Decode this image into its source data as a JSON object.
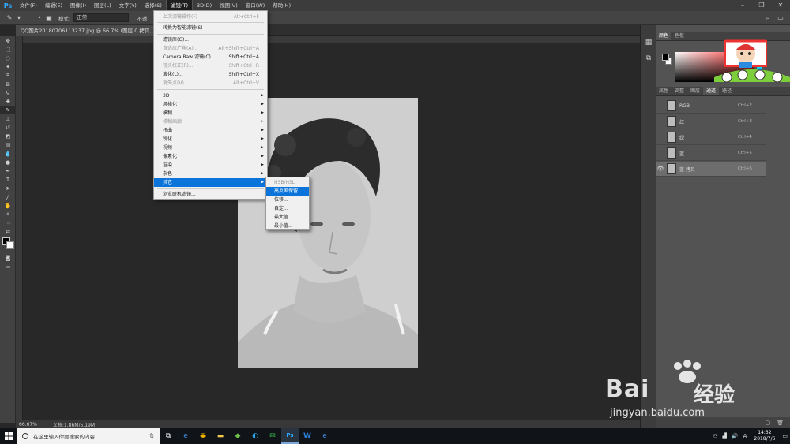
{
  "app": {
    "logo": "Ps"
  },
  "menubar": {
    "items": [
      "文件(F)",
      "编辑(E)",
      "图像(I)",
      "图层(L)",
      "文字(Y)",
      "选择(S)",
      "滤镜(T)",
      "3D(D)",
      "视图(V)",
      "窗口(W)",
      "帮助(H)"
    ],
    "active_index": 6
  },
  "options": {
    "mode_label": "模式:",
    "mode_value": "正常",
    "opacity_label": "不透"
  },
  "document": {
    "tab_title": "QQ图片20180706113237.jpg @ 66.7% (图层 0 拷贝, 蓝 拷贝"
  },
  "status": {
    "zoom": "66.67%",
    "doc_info": "文档:1.86M/5.19M"
  },
  "filter_menu": {
    "items": [
      {
        "label": "上次滤镜操作(F)",
        "shortcut": "Alt+Ctrl+F",
        "disabled": true
      },
      {
        "label": "转换为智能滤镜(S)",
        "shortcut": "",
        "disabled": false
      },
      {
        "label": "滤镜库(G)...",
        "shortcut": "",
        "disabled": false
      },
      {
        "label": "自适应广角(A)...",
        "shortcut": "Alt+Shift+Ctrl+A",
        "disabled": true
      },
      {
        "label": "Camera Raw 滤镜(C)...",
        "shortcut": "Shift+Ctrl+A",
        "disabled": false
      },
      {
        "label": "镜头校正(R)...",
        "shortcut": "Shift+Ctrl+R",
        "disabled": true
      },
      {
        "label": "液化(L)...",
        "shortcut": "Shift+Ctrl+X",
        "disabled": false
      },
      {
        "label": "消失点(V)...",
        "shortcut": "Alt+Ctrl+V",
        "disabled": true
      },
      {
        "label": "3D",
        "shortcut": "",
        "disabled": false,
        "submenu": true
      },
      {
        "label": "风格化",
        "shortcut": "",
        "disabled": false,
        "submenu": true
      },
      {
        "label": "模糊",
        "shortcut": "",
        "disabled": false,
        "submenu": true
      },
      {
        "label": "模糊画廊",
        "shortcut": "",
        "disabled": true,
        "submenu": true
      },
      {
        "label": "扭曲",
        "shortcut": "",
        "disabled": false,
        "submenu": true
      },
      {
        "label": "锐化",
        "shortcut": "",
        "disabled": false,
        "submenu": true
      },
      {
        "label": "视频",
        "shortcut": "",
        "disabled": false,
        "submenu": true
      },
      {
        "label": "像素化",
        "shortcut": "",
        "disabled": false,
        "submenu": true
      },
      {
        "label": "渲染",
        "shortcut": "",
        "disabled": false,
        "submenu": true
      },
      {
        "label": "杂色",
        "shortcut": "",
        "disabled": false,
        "submenu": true
      },
      {
        "label": "其它",
        "shortcut": "",
        "disabled": false,
        "submenu": true,
        "highlighted": true
      },
      {
        "label": "浏览联机滤镜...",
        "shortcut": "",
        "disabled": false
      }
    ]
  },
  "submenu": {
    "items": [
      {
        "label": "HSB/HSL",
        "disabled": true
      },
      {
        "label": "高反差保留...",
        "highlighted": true
      },
      {
        "label": "位移..."
      },
      {
        "label": "自定..."
      },
      {
        "label": "最大值..."
      },
      {
        "label": "最小值..."
      }
    ]
  },
  "color_panel": {
    "tabs": [
      "颜色",
      "色板"
    ]
  },
  "channels_panel": {
    "tabs": [
      "属性",
      "调整",
      "图层",
      "通道",
      "路径"
    ],
    "active_tab": 3,
    "channels": [
      {
        "name": "RGB",
        "shortcut": "Ctrl+2"
      },
      {
        "name": "红",
        "shortcut": "Ctrl+3"
      },
      {
        "name": "绿",
        "shortcut": "Ctrl+4"
      },
      {
        "name": "蓝",
        "shortcut": "Ctrl+5"
      },
      {
        "name": "蓝 拷贝",
        "shortcut": "Ctrl+6",
        "selected": true,
        "visible": true
      }
    ]
  },
  "taskbar": {
    "search_placeholder": "在这里输入你要搜索的内容",
    "time": "14:32",
    "date": "2018/7/6",
    "ime": "A"
  },
  "watermark": {
    "brand": "Bai",
    "brand2": "经验",
    "url": "jingyan.baidu.com"
  },
  "colors": {
    "accent": "#0a74da",
    "ps_blue": "#31a8ff"
  }
}
